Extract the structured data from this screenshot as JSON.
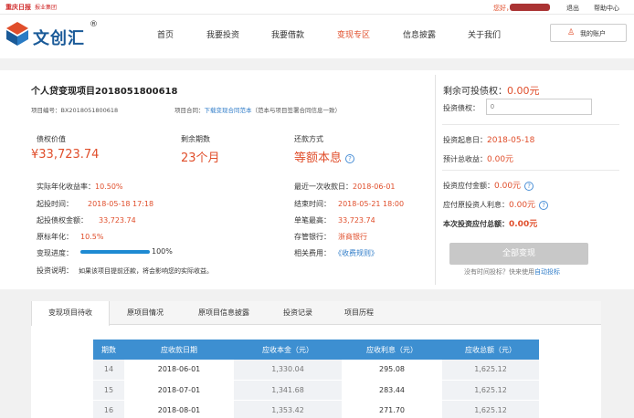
{
  "topbar": {
    "brand": "重庆日报",
    "brand_sub": "报业集团",
    "greeting": "您好，",
    "links": [
      "退出",
      "帮助中心"
    ]
  },
  "logo": {
    "text": "文创汇",
    "reg": "®"
  },
  "nav": [
    {
      "label": "首页"
    },
    {
      "label": "我要投资"
    },
    {
      "label": "我要借款"
    },
    {
      "label": "变现专区",
      "active": true
    },
    {
      "label": "信息披露"
    },
    {
      "label": "关于我们"
    }
  ],
  "account": {
    "label": "我的账户"
  },
  "project": {
    "title": "个人贷变现项目2018051800618",
    "id_label": "项目编号：BX2018051800618",
    "contract_label": "项目合同：",
    "contract_link": "下载变现合同范本",
    "contract_note": "（范本与项目签署合同信息一致）",
    "stats": [
      {
        "label": "债权价值",
        "value": "¥33,723.74"
      },
      {
        "label": "剩余期数",
        "value": "23个月"
      },
      {
        "label": "还款方式",
        "value": "等额本息",
        "help": "?"
      }
    ],
    "details_left": [
      {
        "label": "实际年化收益率：",
        "value": "10.50%"
      },
      {
        "label": "起投时间：",
        "value": "2018-05-18 17:18"
      },
      {
        "label": "起投债权金额：",
        "value": "33,723.74"
      },
      {
        "label": "原标年化：",
        "value": "10.5%"
      },
      {
        "label": "变现进度：",
        "value": "100%"
      },
      {
        "label": "投资说明：",
        "value": "如果该项目提前还款，将会影响您的实际收益。"
      }
    ],
    "progress": 100,
    "details_right": [
      {
        "label": "最近一次收款日：",
        "value": "2018-06-01"
      },
      {
        "label": "结束时间：",
        "value": "2018-05-21 18:00"
      },
      {
        "label": "单笔最高：",
        "value": "33,723.74"
      },
      {
        "label": "存管银行：",
        "value": "浙商银行"
      },
      {
        "label": "相关费用：",
        "value": "《收费规则》"
      }
    ]
  },
  "panel": {
    "remaining_label": "剩余可投债权：",
    "remaining_value": "0.00元",
    "invest_label": "投资债权：",
    "invest_placeholder": "0",
    "start_label": "投资起息日：",
    "start_value": "2018-05-18",
    "expected_label": "预计总收益：",
    "expected_value": "0.00元",
    "due_label": "投资应付金额：",
    "due_value": "0.00元",
    "interest_label": "应付原投资人利息：",
    "interest_value": "0.00元",
    "total_label": "本次投资应付总额：",
    "total_value": "0.00元",
    "button": "全部变现",
    "hint_prefix": "没有时间投标？快来使用",
    "hint_link": "自动投标"
  },
  "tabs": [
    {
      "label": "变现项目待收",
      "active": true
    },
    {
      "label": "原项目情况"
    },
    {
      "label": "原项目信息披露"
    },
    {
      "label": "投资记录"
    },
    {
      "label": "项目历程"
    }
  ],
  "schedule": {
    "headers": [
      "期数",
      "应收款日期",
      "应收本金（元）",
      "应收利息（元）",
      "应收总额（元）"
    ],
    "rows": [
      [
        "14",
        "2018-06-01",
        "1,330.04",
        "295.08",
        "1,625.12"
      ],
      [
        "15",
        "2018-07-01",
        "1,341.68",
        "283.44",
        "1,625.12"
      ],
      [
        "16",
        "2018-08-01",
        "1,353.42",
        "271.70",
        "1,625.12"
      ]
    ]
  },
  "colors": {
    "accent": "#e04e2b",
    "brand_blue": "#1a5a98",
    "table_header": "#3d8fd1"
  }
}
